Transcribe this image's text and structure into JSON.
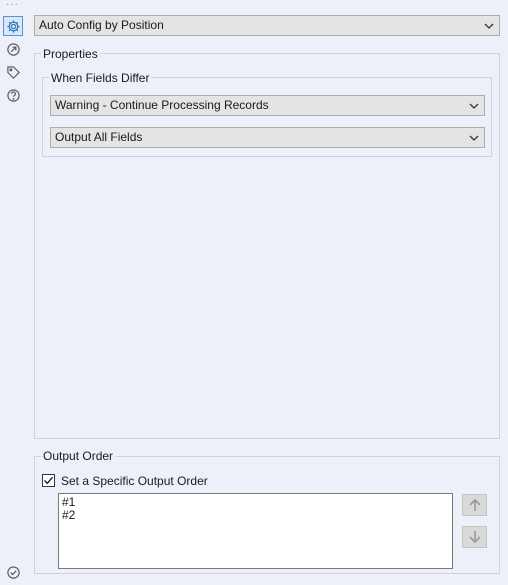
{
  "config_mode": {
    "selected": "Auto Config by Position"
  },
  "properties": {
    "title": "Properties",
    "when_fields_differ": {
      "title": "When Fields Differ",
      "error_mode": "Warning - Continue Processing Records",
      "field_mode": "Output All Fields"
    }
  },
  "output_order": {
    "title": "Output Order",
    "checkbox_label": "Set a Specific Output Order",
    "checked": true,
    "items": [
      "#1",
      "#2"
    ]
  },
  "sidebar": {
    "icons": [
      "gear-icon",
      "connection-icon",
      "tag-icon",
      "help-icon"
    ],
    "footer_icon": "check-circle-icon"
  },
  "colors": {
    "background": "#eef0f9",
    "active_icon": "#1e73be"
  }
}
